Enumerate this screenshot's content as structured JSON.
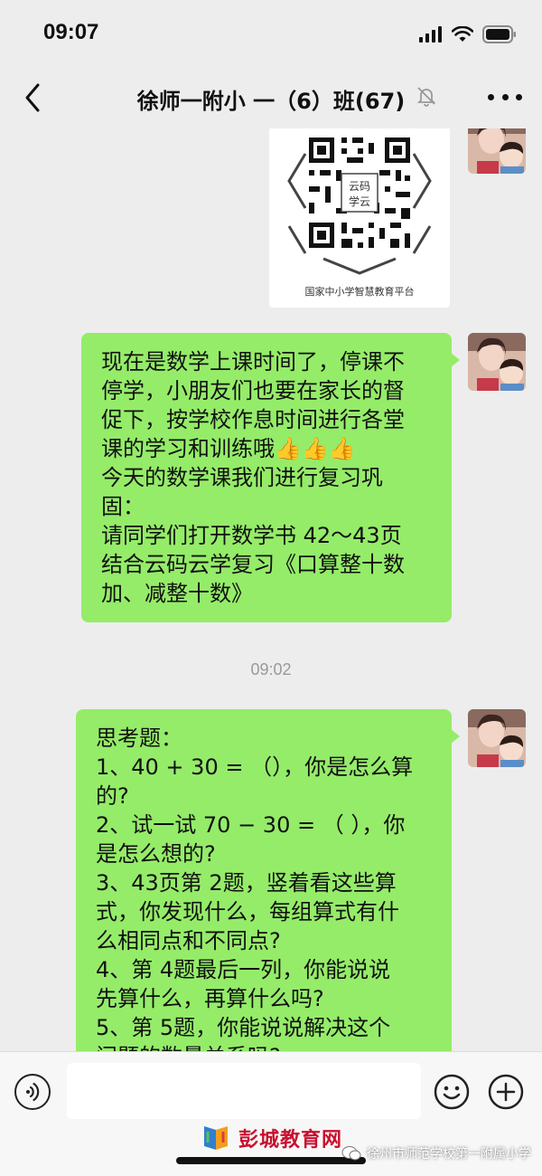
{
  "status_bar": {
    "time": "09:07"
  },
  "nav": {
    "title": "徐师一附小 一（6）班(67)"
  },
  "chat": {
    "qr_card": {
      "center_label": "云码\n学云",
      "caption": "国家中小学智慧教育平台"
    },
    "message_1": {
      "lines": [
        "现在是数学上课时间了，停课不",
        "停学，小朋友们也要在家长的督",
        "促下，按学校作息时间进行各堂",
        "课的学习和训练哦👍👍👍",
        "今天的数学课我们进行复习巩",
        "固：",
        "请同学们打开数学书 42～43页",
        "结合云码云学复习《口算整十数",
        "加、减整十数》"
      ]
    },
    "timestamp": "09:02",
    "message_2": {
      "lines": [
        "思考题：",
        "1、40 + 30 = （），你是怎么算",
        "的?",
        "2、试一试 70 − 30 = （ ），你",
        "是怎么想的?",
        "3、43页第 2题，竖着看这些算",
        "式，你发现什么，每组算式有什",
        "么相同点和不同点?",
        "4、第 4题最后一列，你能说说",
        "先算什么，再算什么吗?",
        "5、第 5题，你能说说解决这个",
        "问题的数量关系吗?"
      ]
    }
  },
  "watermark": {
    "site_name": "彭城教育网",
    "account_name": "徐州市师范学校第一附属小学"
  },
  "colors": {
    "bubble": "#95ec69",
    "background": "#ededed",
    "watermark_red": "#c8102e"
  }
}
